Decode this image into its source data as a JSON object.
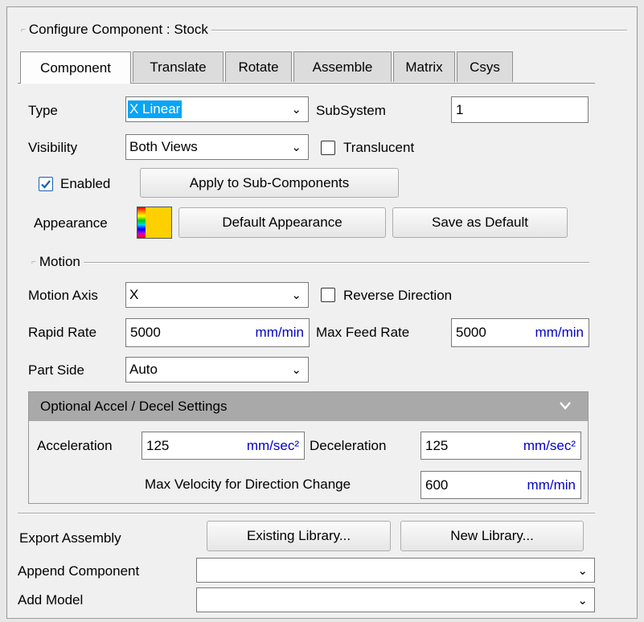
{
  "panel": {
    "title": "Configure Component : Stock"
  },
  "tabs": [
    "Component",
    "Translate",
    "Rotate",
    "Assemble",
    "Matrix",
    "Csys"
  ],
  "component": {
    "type_label": "Type",
    "type_value": "X Linear",
    "subsystem_label": "SubSystem",
    "subsystem_value": "1",
    "visibility_label": "Visibility",
    "visibility_value": "Both Views",
    "translucent_label": "Translucent",
    "translucent_checked": false,
    "enabled_label": "Enabled",
    "enabled_checked": true,
    "apply_sub_button": "Apply to Sub-Components",
    "appearance_label": "Appearance",
    "default_appearance_button": "Default Appearance",
    "save_default_button": "Save as Default",
    "appearance_color": "#ffd000"
  },
  "motion": {
    "group_title": "Motion",
    "axis_label": "Motion Axis",
    "axis_value": "X",
    "reverse_label": "Reverse Direction",
    "reverse_checked": false,
    "rapid_label": "Rapid Rate",
    "rapid_value": "5000",
    "rapid_unit": "mm/min",
    "maxfeed_label": "Max Feed Rate",
    "maxfeed_value": "5000",
    "maxfeed_unit": "mm/min",
    "partside_label": "Part Side",
    "partside_value": "Auto"
  },
  "accel": {
    "header": "Optional Accel / Decel Settings",
    "accel_label": "Acceleration",
    "accel_value": "125",
    "accel_unit": "mm/sec²",
    "decel_label": "Deceleration",
    "decel_value": "125",
    "decel_unit": "mm/sec²",
    "maxvel_label": "Max Velocity for Direction Change",
    "maxvel_value": "600",
    "maxvel_unit": "mm/min"
  },
  "bottom": {
    "export_label": "Export Assembly",
    "existing_button": "Existing Library...",
    "new_button": "New Library...",
    "append_label": "Append Component",
    "append_value": "",
    "addmodel_label": "Add Model",
    "addmodel_value": ""
  }
}
